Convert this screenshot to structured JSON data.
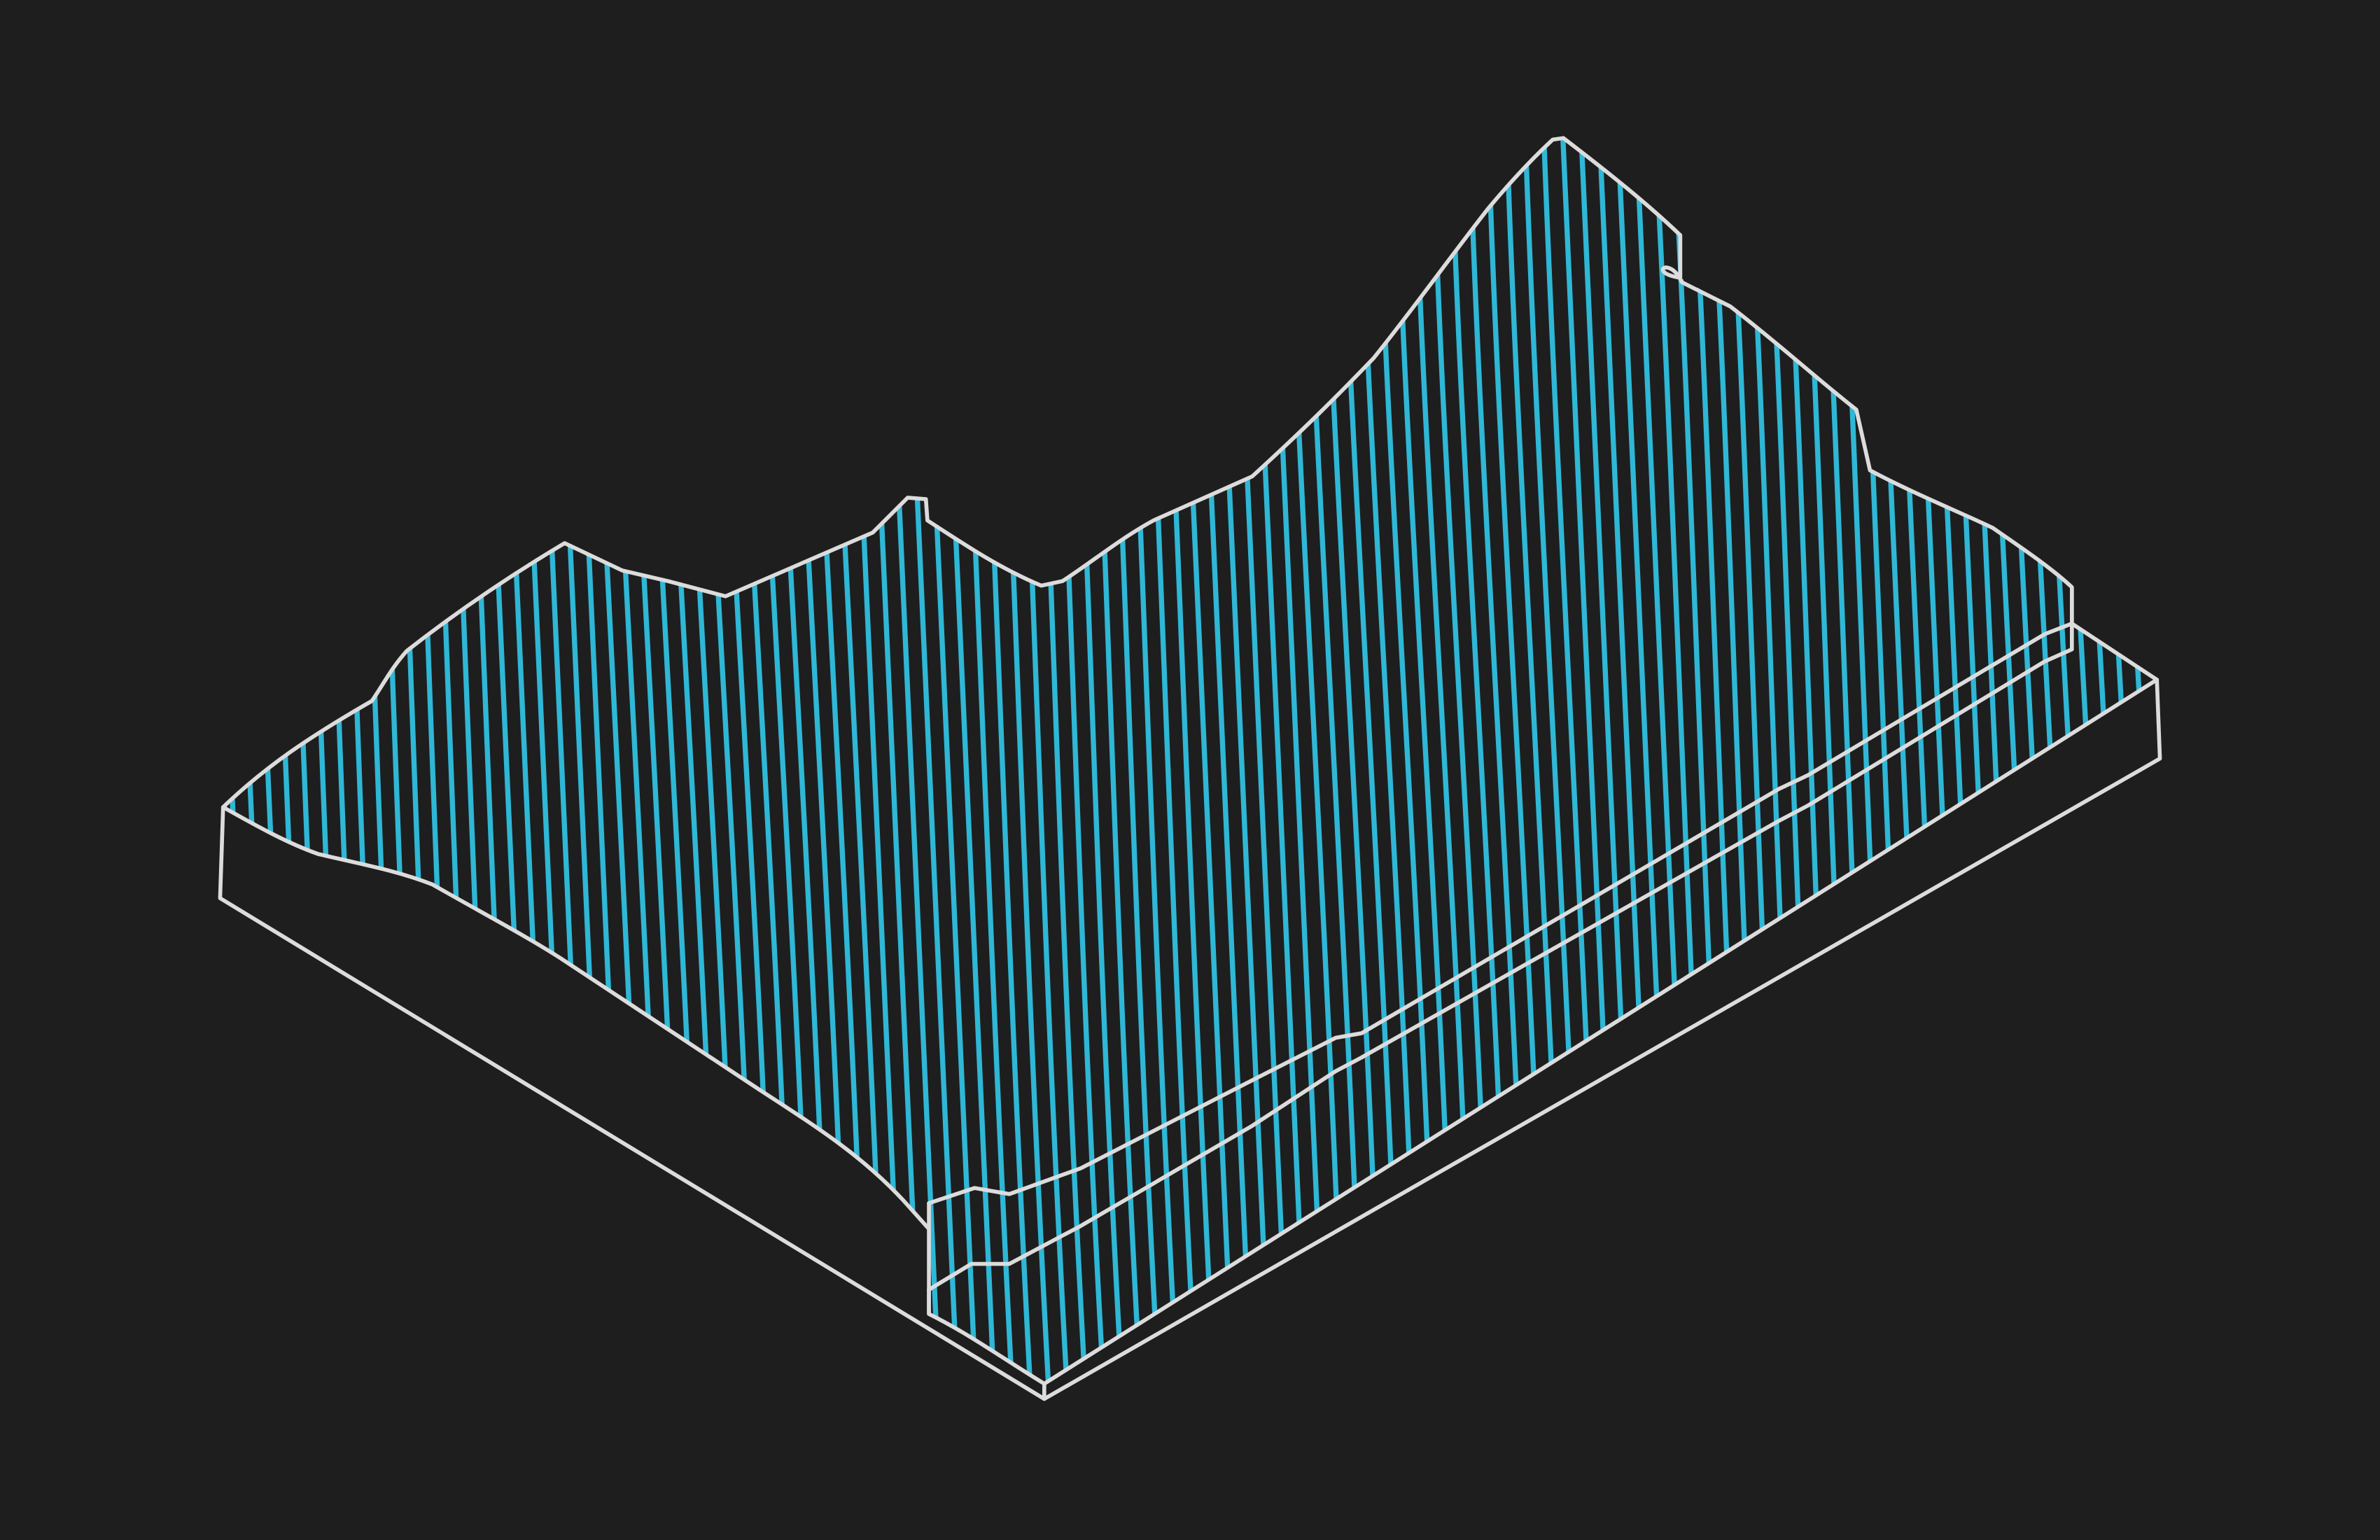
{
  "scene": {
    "background": "#1e1e1e",
    "surface_hatch_color": "#2fb7d6",
    "outline_color": "#dcdcdc",
    "hatch_line_count": 110
  }
}
